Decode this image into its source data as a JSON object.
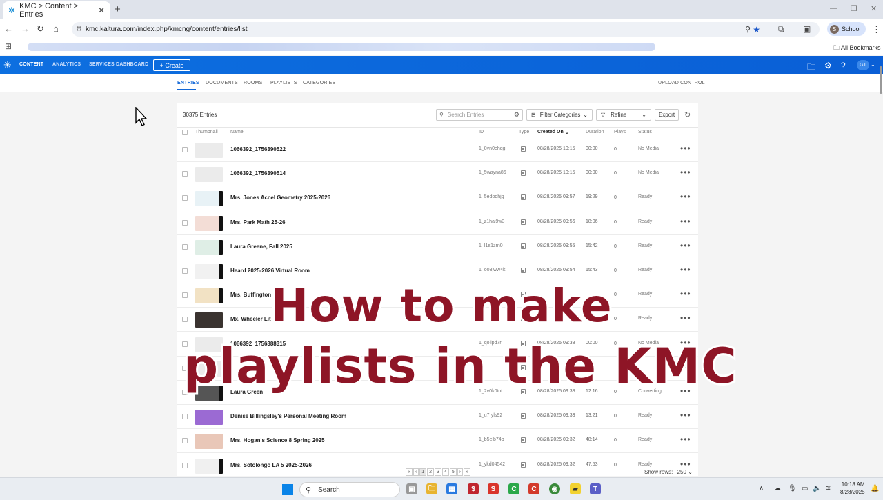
{
  "browser": {
    "tab_title": "KMC > Content > Entries",
    "url": "kmc.kaltura.com/index.php/kmcng/content/entries/list",
    "profile_label": "School",
    "profile_initial": "S",
    "bookmarks_label": "All Bookmarks"
  },
  "kmc": {
    "nav": [
      "CONTENT",
      "ANALYTICS",
      "SERVICES DASHBOARD"
    ],
    "create_label": "+ Create",
    "user_initials": "GT",
    "subtabs": [
      "ENTRIES",
      "DOCUMENTS",
      "ROOMS",
      "PLAYLISTS",
      "CATEGORIES"
    ],
    "upload_control": "UPLOAD CONTROL",
    "accent_color": "#0d6fe0"
  },
  "entries": {
    "count_label": "30375 Entries",
    "search_placeholder": "Search Entries",
    "filter_categories": "Filter Categories",
    "refine": "Refine",
    "export": "Export",
    "columns": [
      "Thumbnail",
      "Name",
      "ID",
      "Type",
      "Created On",
      "Duration",
      "Plays",
      "Status"
    ],
    "rows": [
      {
        "name": "1066392_1756390522",
        "id": "1_8vn0ehqg",
        "date": "08/28/2025 10:15",
        "duration": "00:00",
        "plays": "0",
        "status": "No Media"
      },
      {
        "name": "1066392_1756390514",
        "id": "1_5wayna86",
        "date": "08/28/2025 10:15",
        "duration": "00:00",
        "plays": "0",
        "status": "No Media"
      },
      {
        "name": "Mrs. Jones Accel Geometry 2025-2026",
        "id": "1_5edoqhjg",
        "date": "08/28/2025 09:57",
        "duration": "19:29",
        "plays": "0",
        "status": "Ready"
      },
      {
        "name": "Mrs. Park Math 25-26",
        "id": "1_z1hai9w3",
        "date": "08/28/2025 09:56",
        "duration": "18:06",
        "plays": "0",
        "status": "Ready"
      },
      {
        "name": "Laura Greene, Fall 2025",
        "id": "1_l1e1zrn0",
        "date": "08/28/2025 09:55",
        "duration": "15:42",
        "plays": "0",
        "status": "Ready"
      },
      {
        "name": "Heard 2025-2026 Virtual Room",
        "id": "1_o03jww4k",
        "date": "08/28/2025 09:54",
        "duration": "15:43",
        "plays": "0",
        "status": "Ready"
      },
      {
        "name": "Mrs. Buffington",
        "id": "",
        "date": "",
        "duration": "",
        "plays": "0",
        "status": "Ready"
      },
      {
        "name": "Mx. Wheeler Lit",
        "id": "",
        "date": "",
        "duration": "",
        "plays": "0",
        "status": "Ready"
      },
      {
        "name": "1066392_1756388315",
        "id": "1_qoilpd7r",
        "date": "08/28/2025 09:38",
        "duration": "00:00",
        "plays": "0",
        "status": "No Media"
      },
      {
        "name": "",
        "id": "",
        "date": "",
        "duration": "",
        "plays": "",
        "status": ""
      },
      {
        "name": "Laura Green",
        "id": "1_2v0k0tot",
        "date": "08/28/2025 09:38",
        "duration": "12:16",
        "plays": "0",
        "status": "Converting"
      },
      {
        "name": "Denise Billingsley's Personal Meeting Room",
        "id": "1_u7ryls92",
        "date": "08/28/2025 09:33",
        "duration": "13:21",
        "plays": "0",
        "status": "Ready"
      },
      {
        "name": "Mrs. Hogan's Science 8 Spring 2025",
        "id": "1_b5elb74b",
        "date": "08/28/2025 09:32",
        "duration": "48:14",
        "plays": "0",
        "status": "Ready"
      },
      {
        "name": "Mrs. Sotolongo LA 5 2025-2026",
        "id": "1_ykd04542",
        "date": "08/28/2025 09:32",
        "duration": "47:53",
        "plays": "0",
        "status": "Ready"
      }
    ],
    "pages": [
      "1",
      "2",
      "3",
      "4",
      "5"
    ],
    "show_rows_label": "Show rows:",
    "show_rows_value": "250"
  },
  "overlay": {
    "line1": "How to make",
    "line2": "playlists in the KMC",
    "color": "#8e1526"
  },
  "taskbar": {
    "search_label": "Search",
    "time": "10:18 AM",
    "date": "8/28/2025"
  }
}
